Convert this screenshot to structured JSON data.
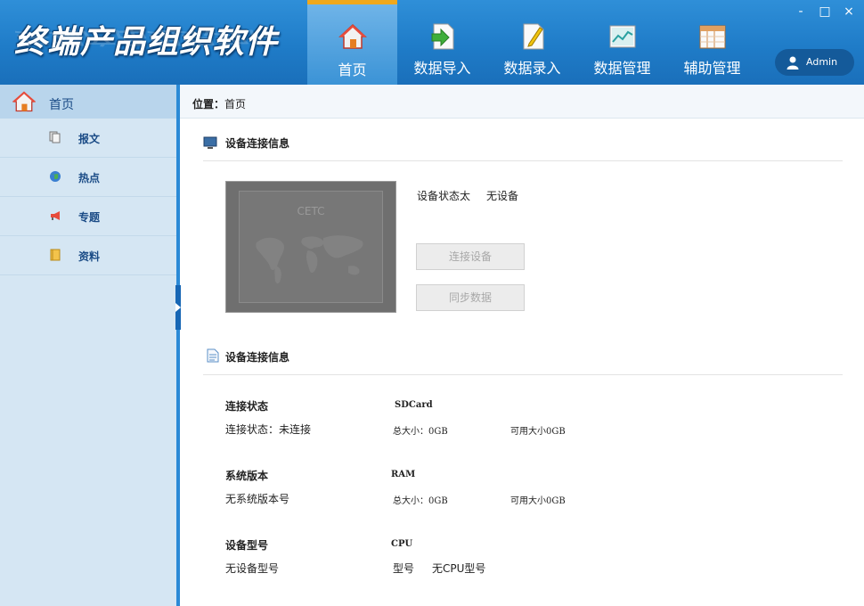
{
  "app": {
    "title": "终端产品组织软件"
  },
  "nav": [
    {
      "label": "首页",
      "icon": "home-icon"
    },
    {
      "label": "数据导入",
      "icon": "import-icon"
    },
    {
      "label": "数据录入",
      "icon": "edit-icon"
    },
    {
      "label": "数据管理",
      "icon": "chart-icon"
    },
    {
      "label": "辅助管理",
      "icon": "table-icon"
    }
  ],
  "window_controls": {
    "minimize": "-",
    "maximize": "□",
    "close": "×"
  },
  "user": {
    "name": "Admin"
  },
  "sidebar": {
    "head": "首页",
    "items": [
      {
        "label": "报文",
        "icon": "document-icon"
      },
      {
        "label": "热点",
        "icon": "globe-icon"
      },
      {
        "label": "专题",
        "icon": "megaphone-icon"
      },
      {
        "label": "资料",
        "icon": "folder-icon"
      }
    ]
  },
  "breadcrumb": {
    "key": "位置：",
    "value": "首页"
  },
  "section1": {
    "title": "设备连接信息"
  },
  "device": {
    "brand": "CETC",
    "status_label": "设备状态太",
    "status_value": "无设备",
    "connect_button": "连接设备",
    "sync_button": "同步数据"
  },
  "section2": {
    "title": "设备连接信息"
  },
  "info": {
    "conn_title": "连接状态",
    "conn_text": "连接状态：未连接",
    "sd_title": "SDCard",
    "sd_total": "总大小：0GB",
    "sd_avail": "可用大小0GB",
    "sys_title": "系统版本",
    "sys_text": "无系统版本号",
    "ram_title": "RAM",
    "ram_total": "总大小：0GB",
    "ram_avail": "可用大小0GB",
    "model_title": "设备型号",
    "model_text": "无设备型号",
    "cpu_title": "CPU",
    "cpu_model_label": "型号",
    "cpu_model_value": "无CPU型号"
  },
  "colors": {
    "header": "#1f7cc8",
    "active_tab_border": "#f0a81c",
    "sidebar": "#d5e6f3",
    "rail": "#2b8ad6"
  }
}
